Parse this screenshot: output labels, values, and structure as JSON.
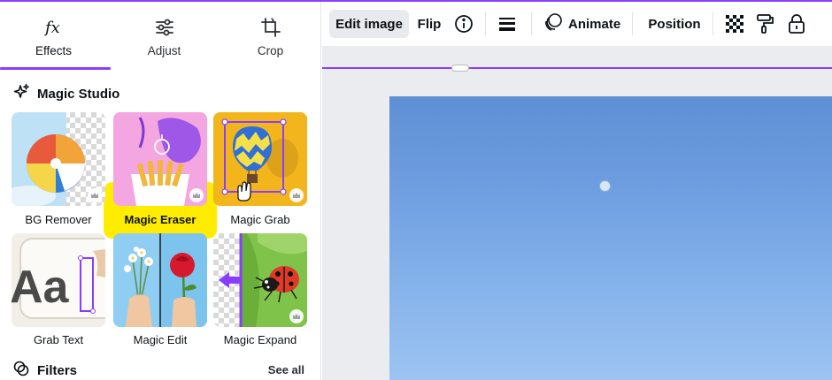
{
  "side_panel": {
    "tabs": [
      {
        "label": "Effects",
        "icon": "fx-icon",
        "active": true
      },
      {
        "label": "Adjust",
        "icon": "sliders-icon",
        "active": false
      },
      {
        "label": "Crop",
        "icon": "crop-icon",
        "active": false
      }
    ],
    "magic_studio": {
      "title": "Magic Studio",
      "tools": [
        {
          "label": "BG Remover",
          "premium": true
        },
        {
          "label": "Magic Eraser",
          "premium": true,
          "highlighted": true
        },
        {
          "label": "Magic Grab",
          "premium": true
        },
        {
          "label": "Grab Text",
          "premium": false
        },
        {
          "label": "Magic Edit",
          "premium": false
        },
        {
          "label": "Magic Expand",
          "premium": true
        }
      ]
    },
    "filters": {
      "title": "Filters",
      "see_all": "See all"
    }
  },
  "toolbar": {
    "edit_image": "Edit image",
    "flip": "Flip",
    "info_icon": "info-icon",
    "menu_icon": "lines-icon",
    "animate": "Animate",
    "position": "Position",
    "transparency_icon": "transparency-icon",
    "paint_roller_icon": "paint-roller-icon",
    "lock_icon": "lock-icon"
  },
  "colors": {
    "accent": "#8b3dff",
    "highlight": "#ffec00",
    "sky": "#6d9de0"
  }
}
